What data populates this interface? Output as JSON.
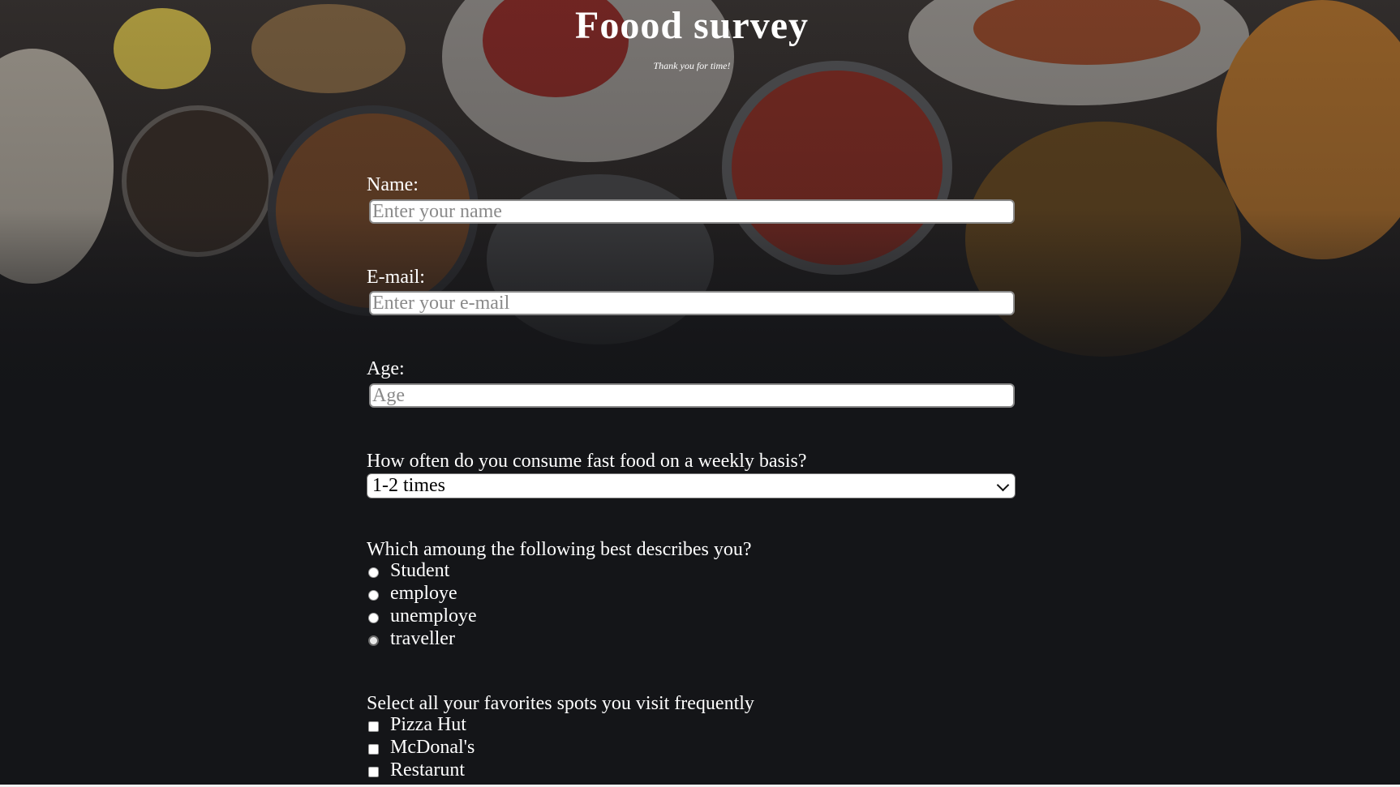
{
  "header": {
    "title": "Foood survey",
    "subtitle": "Thank you for time!"
  },
  "form": {
    "name": {
      "label": "Name:",
      "placeholder": "Enter your name",
      "value": ""
    },
    "email": {
      "label": "E-mail:",
      "placeholder": "Enter your e-mail",
      "value": ""
    },
    "age": {
      "label": "Age:",
      "placeholder": "Age",
      "value": ""
    },
    "frequency": {
      "label": "How often do you consume fast food on a weekly basis?",
      "selected": "1-2 times"
    },
    "describe": {
      "label": "Which amoung the following best describes you?",
      "options": [
        {
          "label": "Student",
          "checked": false
        },
        {
          "label": "employe",
          "checked": false
        },
        {
          "label": "unemploye",
          "checked": false
        },
        {
          "label": "traveller",
          "checked": false
        }
      ]
    },
    "spots": {
      "label": "Select all your favorites spots you visit frequently",
      "options": [
        {
          "label": "Pizza Hut",
          "checked": false
        },
        {
          "label": "McDonal's",
          "checked": false
        },
        {
          "label": "Restarunt",
          "checked": false
        }
      ]
    }
  },
  "colors": {
    "background": "#141518",
    "text": "#ffffff",
    "input_bg": "#ffffff"
  }
}
